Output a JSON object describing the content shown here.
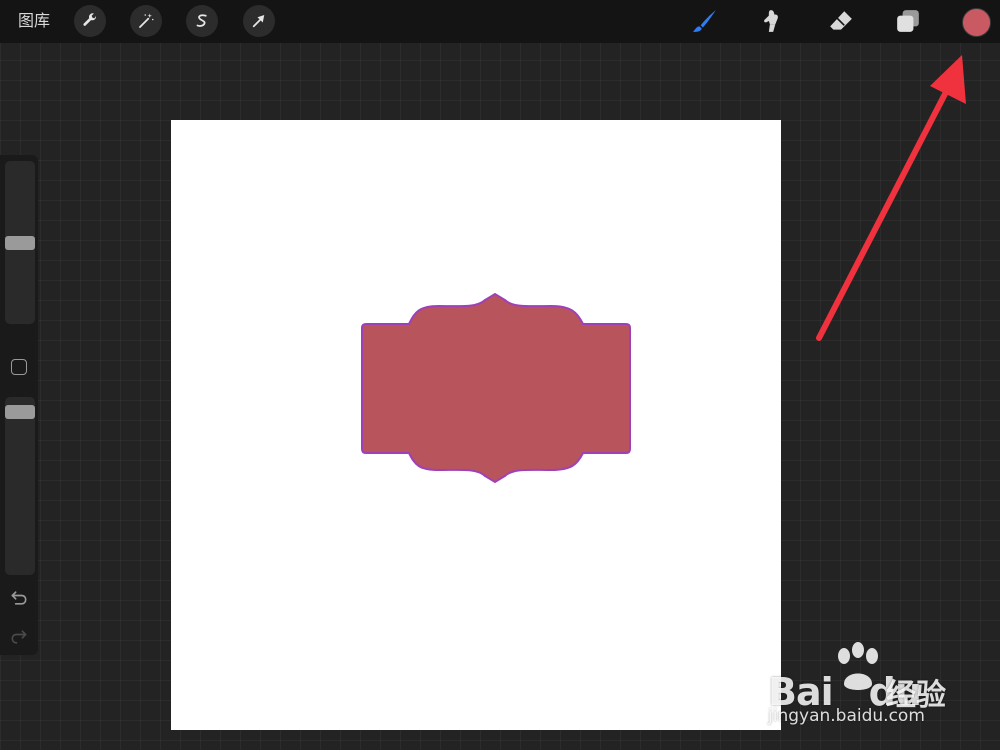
{
  "topbar": {
    "gallery_label": "图库",
    "left_tools": [
      {
        "name": "wrench-icon",
        "action": "actions"
      },
      {
        "name": "magic-wand-icon",
        "action": "adjustments"
      },
      {
        "name": "selection-s-icon",
        "action": "selection"
      },
      {
        "name": "transform-arrow-icon",
        "action": "transform"
      }
    ],
    "right_tools": [
      {
        "name": "brush-icon",
        "active": true
      },
      {
        "name": "smudge-icon"
      },
      {
        "name": "eraser-icon"
      },
      {
        "name": "layers-icon"
      }
    ],
    "active_tool_color": "#2e7cf6",
    "current_color": "#c95a64"
  },
  "canvas": {
    "background": "#ffffff",
    "shape_fill": "#b8545b",
    "shape_stroke": "#a040b8"
  },
  "sidebar": {
    "brush_size_level": 0.5,
    "opacity_level": 0.05
  },
  "annotation": {
    "arrow_color": "#f0323e"
  },
  "watermark": {
    "logo_text": "Bai",
    "logo_text_2": "du",
    "cn_text": "经验",
    "url": "jingyan.baidu.com"
  }
}
